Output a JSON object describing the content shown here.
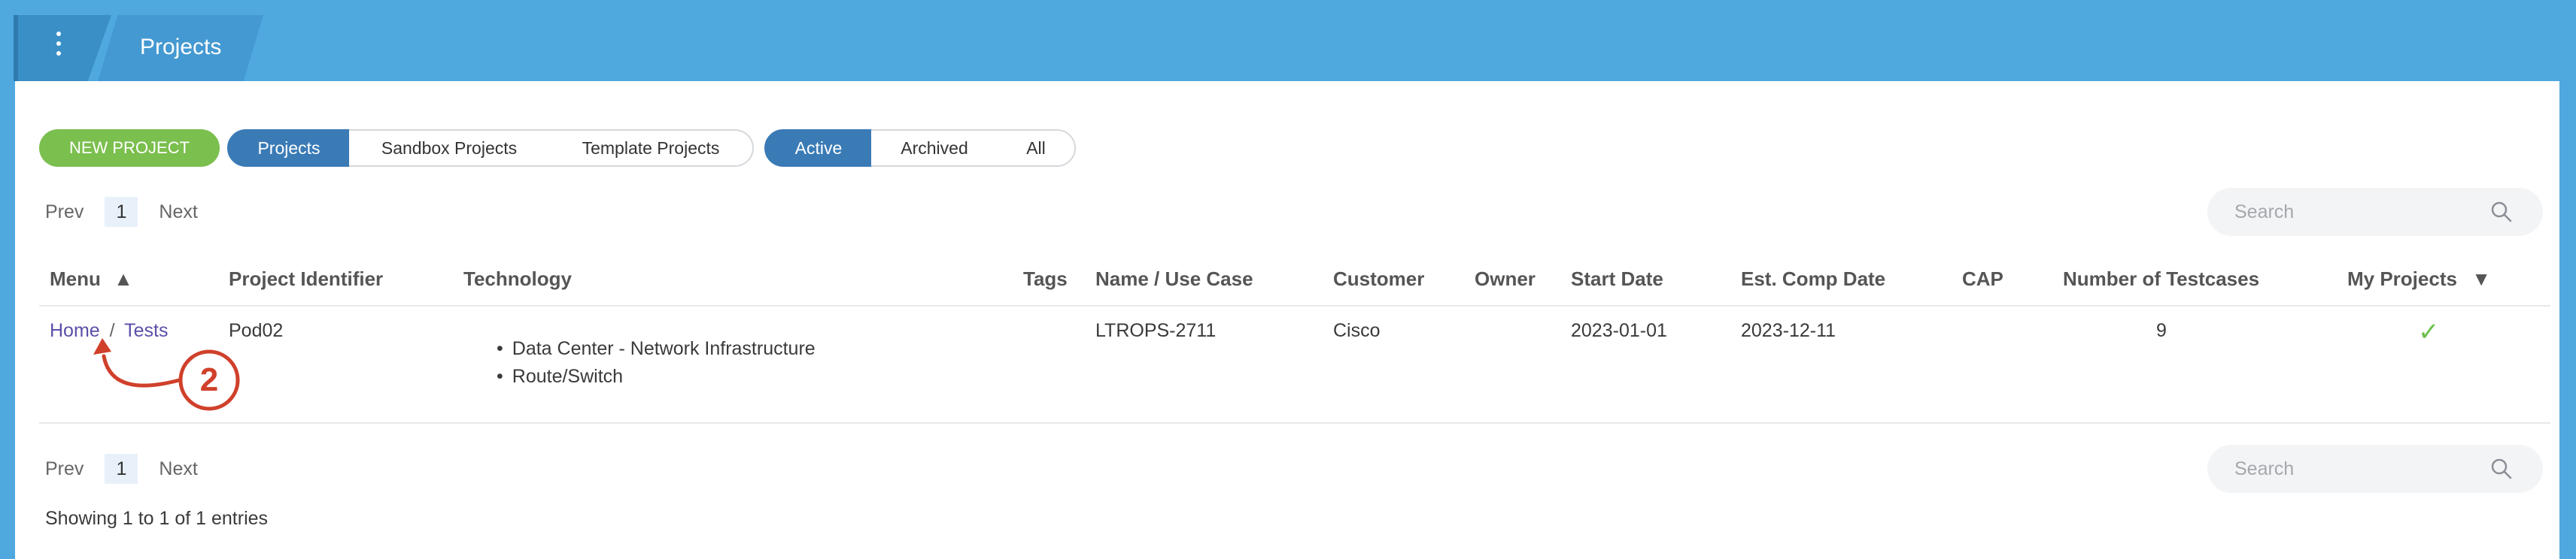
{
  "header": {
    "title": "Projects"
  },
  "toolbar": {
    "new_project_label": "NEW PROJECT",
    "type_tabs": [
      {
        "label": "Projects",
        "active": true
      },
      {
        "label": "Sandbox Projects",
        "active": false
      },
      {
        "label": "Template Projects",
        "active": false
      }
    ],
    "status_tabs": [
      {
        "label": "Active",
        "active": true
      },
      {
        "label": "Archived",
        "active": false
      },
      {
        "label": "All",
        "active": false
      }
    ]
  },
  "pager": {
    "prev_label": "Prev",
    "page": "1",
    "next_label": "Next"
  },
  "search": {
    "placeholder": "Search"
  },
  "table": {
    "headers": {
      "menu": "Menu",
      "menu_sort": "▲",
      "project_identifier": "Project Identifier",
      "technology": "Technology",
      "tags": "Tags",
      "name_use_case": "Name / Use Case",
      "customer": "Customer",
      "owner": "Owner",
      "start_date": "Start Date",
      "est_comp_date": "Est. Comp Date",
      "cap": "CAP",
      "number_of_testcases": "Number of Testcases",
      "my_projects": "My Projects",
      "my_projects_sort": "▼"
    },
    "rows": [
      {
        "menu_home": "Home",
        "menu_sep": "/",
        "menu_tests": "Tests",
        "project_identifier": "Pod02",
        "technology": [
          "Data Center - Network Infrastructure",
          "Route/Switch"
        ],
        "tags": "",
        "name_use_case": "LTROPS-2711",
        "customer": "Cisco",
        "owner": "",
        "start_date": "2023-01-01",
        "est_comp_date": "2023-12-11",
        "cap": "",
        "number_of_testcases": "9",
        "my_projects": "✓"
      }
    ]
  },
  "annotation": {
    "step_number": "2",
    "color": "#d0402b"
  },
  "footer": {
    "entries_text": "Showing 1 to 1 of 1 entries"
  },
  "colors": {
    "header_bg": "#4fa9df",
    "primary": "#3a7bb6",
    "new_button": "#7bbf4e",
    "link": "#5a4fa8",
    "check": "#6cc04a"
  }
}
